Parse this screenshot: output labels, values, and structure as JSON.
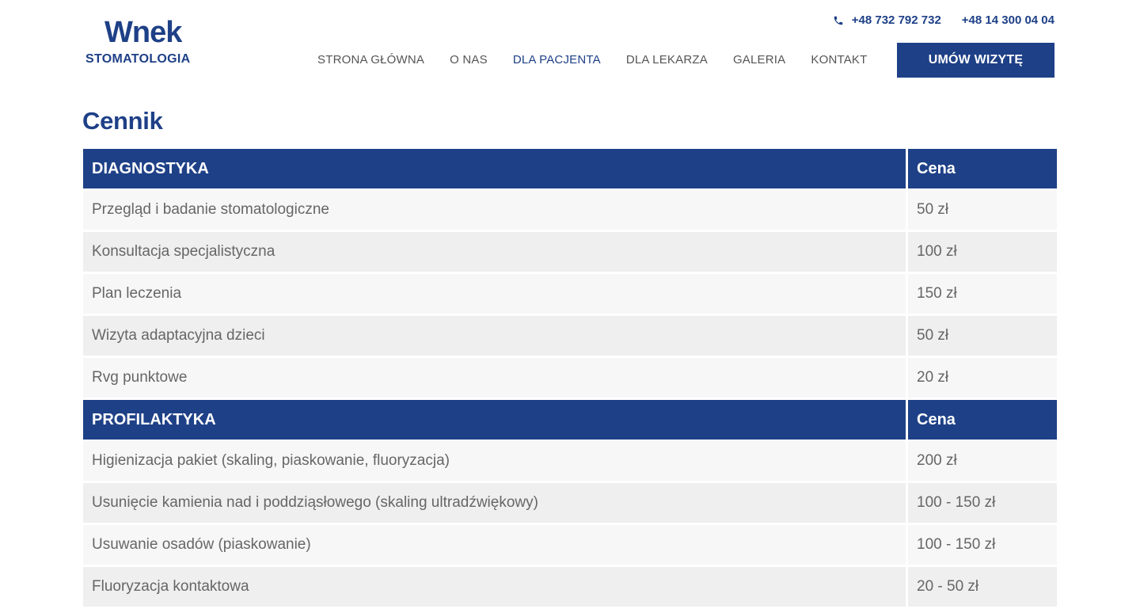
{
  "brand": {
    "name": "Wnek",
    "subtitle": "STOMATOLOGIA"
  },
  "header": {
    "phone_1": "+48 732 792 732",
    "phone_2": "+48 14 300 04 04",
    "cta_label": "UMÓW WIZYTĘ",
    "phone_icon": "phone-icon"
  },
  "nav": {
    "items": [
      {
        "label": "STRONA GŁÓWNA"
      },
      {
        "label": "O NAS"
      },
      {
        "label": "DLA PACJENTA"
      },
      {
        "label": "DLA LEKARZA"
      },
      {
        "label": "GALERIA"
      },
      {
        "label": "KONTAKT"
      }
    ],
    "active": "DLA PACJENTA"
  },
  "page": {
    "title": "Cennik"
  },
  "sections": [
    {
      "heading": "DIAGNOSTYKA",
      "price_heading": "Cena",
      "rows": [
        {
          "name": "Przegląd i badanie stomatologiczne",
          "price": "50 zł"
        },
        {
          "name": "Konsultacja specjalistyczna",
          "price": "100 zł"
        },
        {
          "name": "Plan leczenia",
          "price": "150 zł"
        },
        {
          "name": "Wizyta adaptacyjna dzieci",
          "price": "50 zł"
        },
        {
          "name": "Rvg punktowe",
          "price": "20 zł"
        }
      ]
    },
    {
      "heading": "PROFILAKTYKA",
      "price_heading": "Cena",
      "rows": [
        {
          "name": "Higienizacja pakiet (skaling, piaskowanie, fluoryzacja)",
          "price": "200 zł"
        },
        {
          "name": "Usunięcie kamienia nad i poddziąsłowego (skaling ultradźwiękowy)",
          "price": "100 - 150 zł"
        },
        {
          "name": "Usuwanie osadów (piaskowanie)",
          "price": "100 - 150 zł"
        },
        {
          "name": "Fluoryzacja kontaktowa",
          "price": "20 - 50 zł"
        }
      ]
    }
  ],
  "colors": {
    "brand_blue": "#1e4087",
    "row_light": "#f7f7f7",
    "row_dark": "#efefef"
  }
}
